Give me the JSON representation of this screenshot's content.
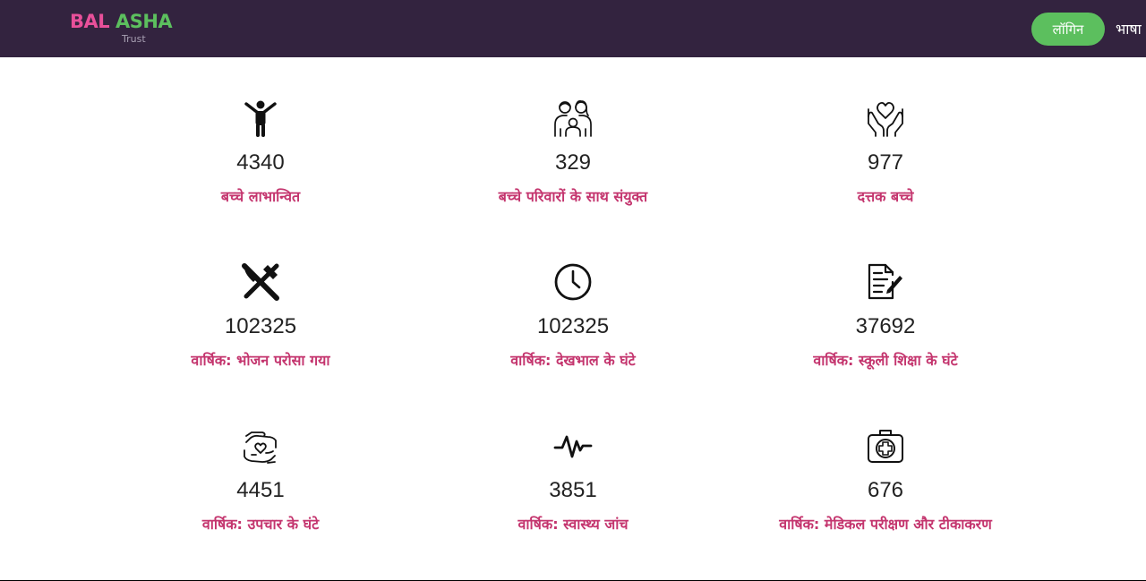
{
  "header": {
    "logo_main_1": "BAL",
    "logo_main_2": " ASHA",
    "logo_sub": "Trust",
    "login_label": "लॉगिन",
    "language_label": "भाषा"
  },
  "colors": {
    "header_bg": "#33233f",
    "brand_pink": "#e8509a",
    "brand_green": "#5cbf5e",
    "label_color": "#c4356e"
  },
  "stats": [
    {
      "icon": "child-icon",
      "value": "4340",
      "label": "बच्चे लाभान्वित"
    },
    {
      "icon": "family-icon",
      "value": "329",
      "label": "बच्चे परिवारों के साथ संयुक्त"
    },
    {
      "icon": "heart-hands-icon",
      "value": "977",
      "label": "दत्तक बच्चे"
    },
    {
      "icon": "fork-knife-icon",
      "value": "102325",
      "label": "वार्षिक: भोजन परोसा गया"
    },
    {
      "icon": "clock-icon",
      "value": "102325",
      "label": "वार्षिक: देखभाल के घंटे"
    },
    {
      "icon": "notepad-icon",
      "value": "37692",
      "label": "वार्षिक: स्कूली शिक्षा के घंटे"
    },
    {
      "icon": "care-hands-icon",
      "value": "4451",
      "label": "वार्षिक: उपचार के घंटे"
    },
    {
      "icon": "heartbeat-icon",
      "value": "3851",
      "label": "वार्षिक: स्वास्थ्य जांच"
    },
    {
      "icon": "medical-kit-icon",
      "value": "676",
      "label": "वार्षिक: मेडिकल परीक्षण और टीकाकरण"
    }
  ]
}
